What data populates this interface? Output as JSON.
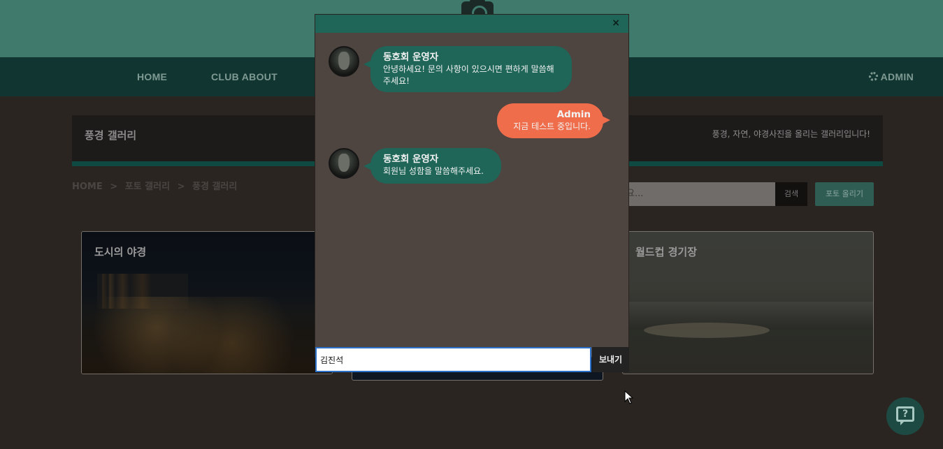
{
  "nav": {
    "home": "HOME",
    "club_about": "CLUB ABOUT",
    "admin": "ADMIN"
  },
  "gallery": {
    "title": "풍경 갤러리",
    "description": "풍경, 자연, 야경사진을 올리는 갤러리입니다!",
    "breadcrumb": [
      "HOME",
      ">",
      "포토 갤러리",
      ">",
      "풍경 갤러리"
    ],
    "search_placeholder": "요...",
    "search_button": "검색",
    "upload_button": "포토 올리기",
    "cards": [
      {
        "title": "도시의 야경"
      },
      {
        "title": ""
      },
      {
        "title": "월드컵 경기장"
      }
    ]
  },
  "chat": {
    "close_label": "×",
    "messages": [
      {
        "sender": "동호회 운영자",
        "text": "안녕하세요! 문의 사항이 있으시면 편하게 말씀해주세요!",
        "side": "left"
      },
      {
        "sender": "Admin",
        "text": "지금 테스트 중입니다.",
        "side": "right"
      },
      {
        "sender": "동호회 운영자",
        "text": "회원님 성함을 말씀해주세요.",
        "side": "left"
      }
    ],
    "input_value": "김진석",
    "send_label": "보내기"
  },
  "help": {
    "icon_label": "?"
  },
  "colors": {
    "chat_header": "#1f6659",
    "operator_bubble": "#1f6659",
    "admin_bubble": "#f06d4b",
    "chat_body": "#4e4440",
    "send_button": "#232323"
  }
}
